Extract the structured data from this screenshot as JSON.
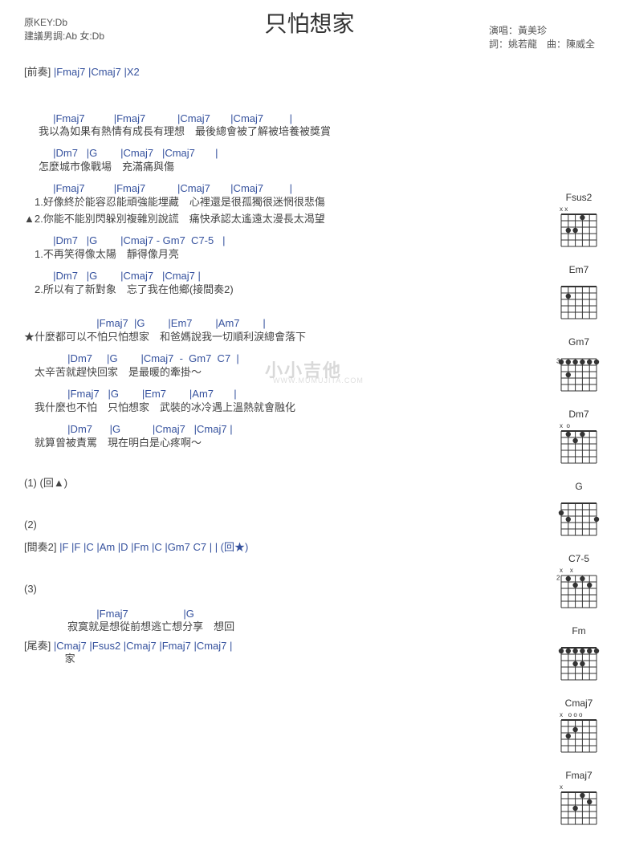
{
  "header": {
    "original_key": "原KEY:Db",
    "suggested_key": "建議男調:Ab 女:Db",
    "title": "只怕想家",
    "singer": "演唱：黃美珍",
    "lyricist_composer": "詞：姚若龍　曲：陳威全"
  },
  "intro": {
    "label": "[前奏]",
    "chords": " |Fmaj7   |Cmaj7   |X2"
  },
  "lines": [
    {
      "chords": "          |Fmaj7          |Fmaj7           |Cmaj7       |Cmaj7         |",
      "lyric": "     我以為如果有熱情有成長有理想　最後總會被了解被培養被獎賞",
      "style": "normal"
    },
    {
      "chords": "          |Dm7   |G        |Cmaj7   |Cmaj7       |",
      "lyric": "     怎麼城市像戰場　充滿痛與傷",
      "style": "normal"
    },
    {
      "chords": "          |Fmaj7          |Fmaj7           |Cmaj7       |Cmaj7         |",
      "lyric": "　1.好像終於能容忍能頑強能埋藏　心裡還是很孤獨很迷惘很悲傷",
      "style": "normal"
    },
    {
      "chords": "",
      "lyric": "▲2.你能不能別閃躲別複雜別說謊　痛快承認太遙遠太漫長太渴望",
      "style": "after"
    },
    {
      "chords": "          |Dm7   |G        |Cmaj7 - Gm7  C7-5   |",
      "lyric": "　1.不再笑得像太陽　靜得像月亮",
      "style": "normal"
    },
    {
      "chords": "          |Dm7   |G        |Cmaj7   |Cmaj7 |",
      "lyric": "　2.所以有了新對象　忘了我在他鄉(接間奏2)",
      "style": "normal"
    },
    {
      "chords": "                         |Fmaj7  |G        |Em7        |Am7        |",
      "lyric": "★什麼都可以不怕只怕想家　和爸媽說我一切順利淚總會落下",
      "style": "chorus"
    },
    {
      "chords": "               |Dm7     |G        |Cmaj7  -  Gm7  C7  |",
      "lyric": "　太辛苦就趕快回家　是最暖的牽掛～",
      "style": "normal"
    },
    {
      "chords": "               |Fmaj7   |G        |Em7        |Am7       |",
      "lyric": "　我什麼也不怕　只怕想家　武裝的冰冷遇上溫熱就會融化",
      "style": "normal"
    },
    {
      "chords": "               |Dm7      |G           |Cmaj7   |Cmaj7 |",
      "lyric": "　就算曾被責罵　現在明白是心疼啊～",
      "style": "normal"
    }
  ],
  "repeat1": "(1) (回▲)",
  "repeat2": "(2)",
  "interlude2": {
    "label": "[間奏2]",
    "chords": " |F   |F   |C   |Am   |D   |Fm   |C   |Gm7  C7  |  | (回★)"
  },
  "repeat3": "(3)",
  "outro_lines": [
    {
      "chords": "                         |Fmaj7                   |G",
      "lyric": "               寂寞就是想從前想逃亡想分享　想回",
      "style": "normal"
    }
  ],
  "outro": {
    "label": "[尾奏]",
    "chords": " |Cmaj7       |Fsus2       |Cmaj7     |Fmaj7       |Cmaj7  |",
    "lyric_tail": "              家"
  },
  "watermark": "小小吉他",
  "watermark_sub": "WWW.MUMUJITA.COM",
  "diagrams": [
    {
      "name": "Fsus2",
      "marks": "x x",
      "fret": 0,
      "dots": [
        [
          4,
          1
        ],
        [
          3,
          3
        ],
        [
          2,
          3
        ]
      ]
    },
    {
      "name": "Em7",
      "marks": "",
      "fret": 0,
      "dots": [
        [
          2,
          2
        ]
      ]
    },
    {
      "name": "Gm7",
      "marks": "",
      "fret": 3,
      "dots": [
        [
          1,
          1
        ],
        [
          2,
          1
        ],
        [
          3,
          1
        ],
        [
          4,
          1
        ],
        [
          5,
          1
        ],
        [
          6,
          1
        ],
        [
          2,
          3
        ]
      ]
    },
    {
      "name": "Dm7",
      "marks": "x  o",
      "fret": 0,
      "dots": [
        [
          4,
          1
        ],
        [
          2,
          1
        ],
        [
          3,
          2
        ]
      ]
    },
    {
      "name": "G",
      "marks": "",
      "fret": 0,
      "dots": [
        [
          1,
          2
        ],
        [
          2,
          3
        ],
        [
          6,
          3
        ]
      ]
    },
    {
      "name": "C7-5",
      "marks": "x    x",
      "fret": 2,
      "dots": [
        [
          2,
          1
        ],
        [
          4,
          1
        ],
        [
          5,
          2
        ],
        [
          3,
          2
        ]
      ]
    },
    {
      "name": "Fm",
      "marks": "",
      "fret": 0,
      "dots": [
        [
          1,
          1
        ],
        [
          2,
          1
        ],
        [
          3,
          1
        ],
        [
          4,
          1
        ],
        [
          5,
          1
        ],
        [
          6,
          1
        ],
        [
          3,
          3
        ],
        [
          4,
          3
        ]
      ]
    },
    {
      "name": "Cmaj7",
      "marks": "x   o o o",
      "fret": 0,
      "dots": [
        [
          3,
          2
        ],
        [
          2,
          3
        ]
      ]
    },
    {
      "name": "Fmaj7",
      "marks": "x",
      "fret": 0,
      "dots": [
        [
          4,
          1
        ],
        [
          5,
          2
        ],
        [
          3,
          3
        ]
      ]
    }
  ],
  "chart_data": null
}
